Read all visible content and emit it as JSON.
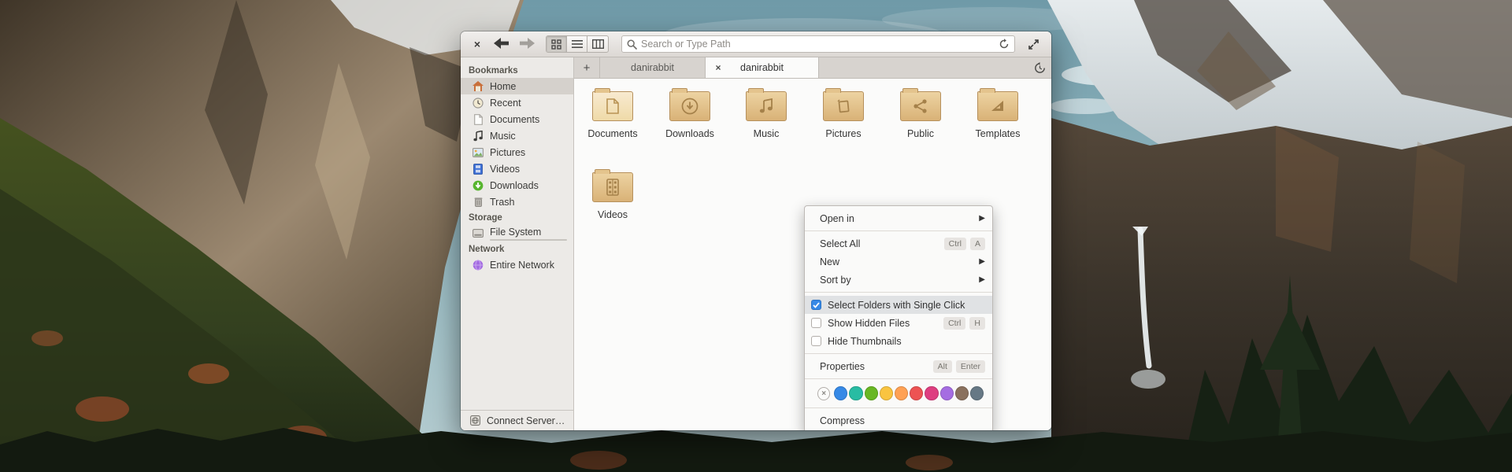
{
  "window": {
    "toolbar": {
      "close_glyph": "×",
      "search_placeholder": "Search or Type Path"
    },
    "tabs": {
      "add_glyph": "+",
      "close_glyph": "×",
      "items": [
        {
          "label": "danirabbit"
        },
        {
          "label": "danirabbit"
        }
      ]
    },
    "sidebar": {
      "bookmarks_header": "Bookmarks",
      "bookmarks": [
        {
          "label": "Home"
        },
        {
          "label": "Recent"
        },
        {
          "label": "Documents"
        },
        {
          "label": "Music"
        },
        {
          "label": "Pictures"
        },
        {
          "label": "Videos"
        },
        {
          "label": "Downloads"
        },
        {
          "label": "Trash"
        }
      ],
      "storage_header": "Storage",
      "storage": [
        {
          "label": "File System",
          "usage_percent": 16
        }
      ],
      "network_header": "Network",
      "network": [
        {
          "label": "Entire Network"
        }
      ],
      "connect_server": "Connect Server…"
    },
    "files": [
      {
        "name": "Documents"
      },
      {
        "name": "Downloads"
      },
      {
        "name": "Music"
      },
      {
        "name": "Pictures"
      },
      {
        "name": "Public"
      },
      {
        "name": "Templates"
      },
      {
        "name": "Videos"
      }
    ],
    "context_menu": {
      "open_in": "Open in",
      "select_all": "Select All",
      "select_all_key1": "Ctrl",
      "select_all_key2": "A",
      "new": "New",
      "sort_by": "Sort by",
      "single_click": "Select Folders with Single Click",
      "show_hidden": "Show Hidden Files",
      "show_hidden_key1": "Ctrl",
      "show_hidden_key2": "H",
      "hide_thumbnails": "Hide Thumbnails",
      "properties": "Properties",
      "properties_key1": "Alt",
      "properties_key2": "Enter",
      "compress": "Compress",
      "clear_color_glyph": "×",
      "colors": [
        "#3689e6",
        "#28bca3",
        "#68b723",
        "#f9c440",
        "#ffa154",
        "#ed5353",
        "#de3e80",
        "#a56de2",
        "#8a715e",
        "#667885"
      ],
      "accent_color": "#3689e6"
    }
  }
}
